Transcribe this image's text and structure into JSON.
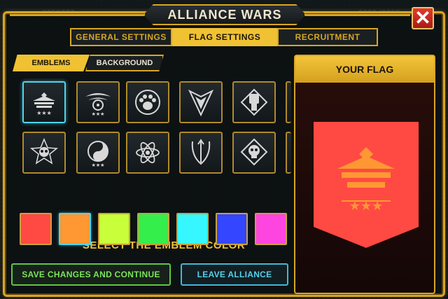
{
  "window": {
    "title": "ALLIANCE WARS",
    "close_label": "✕"
  },
  "background_hud": {
    "resource_left": "2259777",
    "resource_right_1": "9999/9999",
    "resource_right_2": "9999/9999"
  },
  "tabs": [
    {
      "label": "GENERAL SETTINGS",
      "active": false
    },
    {
      "label": "FLAG SETTINGS",
      "active": true
    },
    {
      "label": "RECRUITMENT",
      "active": false
    }
  ],
  "subtabs": [
    {
      "label": "EMBLEMS",
      "active": true
    },
    {
      "label": "BACKGROUND",
      "active": false
    }
  ],
  "emblems": [
    {
      "icon": "eagle-stars-icon",
      "selected": true
    },
    {
      "icon": "wings-radiation-icon",
      "selected": false
    },
    {
      "icon": "paw-icon",
      "selected": false
    },
    {
      "icon": "spearhead-icon",
      "selected": false
    },
    {
      "icon": "fist-icon",
      "selected": false
    },
    {
      "icon": "skull-star-icon",
      "selected": false
    },
    {
      "icon": "yin-yang-icon",
      "selected": false
    },
    {
      "icon": "atom-icon",
      "selected": false
    },
    {
      "icon": "trident-icon",
      "selected": false
    },
    {
      "icon": "skull-diamond-icon",
      "selected": false
    }
  ],
  "color_section": {
    "title": "SELECT THE EMBLEM COLOR"
  },
  "colors": [
    {
      "hex": "#ff4a43",
      "selected": false
    },
    {
      "hex": "#ff9833",
      "selected": true
    },
    {
      "hex": "#c8ff3a",
      "selected": false
    },
    {
      "hex": "#34ef4b",
      "selected": false
    },
    {
      "hex": "#36f7ff",
      "selected": false
    },
    {
      "hex": "#3446ff",
      "selected": false
    },
    {
      "hex": "#ff45e0",
      "selected": false
    }
  ],
  "buttons": {
    "save": "SAVE CHANGES AND CONTINUE",
    "leave": "LEAVE ALLIANCE"
  },
  "flag": {
    "title": "YOUR FLAG",
    "background_color": "#ff4a43",
    "emblem_color": "#ff9833",
    "emblem": "eagle-stars-icon"
  }
}
